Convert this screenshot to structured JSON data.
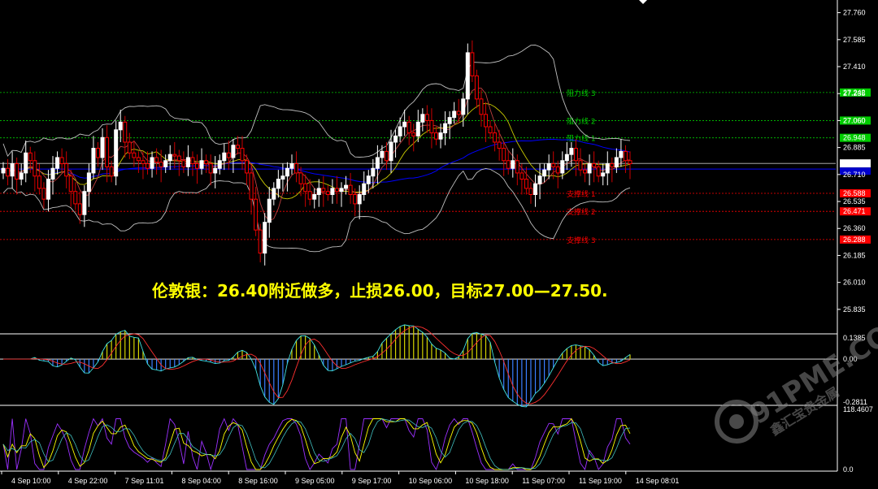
{
  "chart_data": {
    "type": "candlestick",
    "instrument_note": "伦敦银：26.40附近做多，止损26.00，目标27.00—27.50.",
    "price_axis": {
      "ylim": [
        25.75,
        27.8
      ],
      "ticks": [
        "27.760",
        "27.585",
        "27.410",
        "27.235",
        "27.060",
        "26.885",
        "26.710",
        "26.535",
        "26.360",
        "26.185",
        "26.010",
        "25.835"
      ]
    },
    "time_axis": {
      "labels": [
        "4 Sep 10:00",
        "4 Sep 22:00",
        "7 Sep 11:01",
        "8 Sep 04:00",
        "8 Sep 16:00",
        "9 Sep 05:00",
        "9 Sep 17:00",
        "10 Sep 06:00",
        "10 Sep 18:00",
        "11 Sep 07:00",
        "11 Sep 19:00",
        "14 Sep 08:01"
      ]
    },
    "current_price": "26.782",
    "levels": [
      {
        "name": "阻力线 3",
        "value": 27.242,
        "label": "27.242",
        "color": "#00cc00"
      },
      {
        "name": "阻力线 2",
        "value": 27.06,
        "label": "27.060",
        "color": "#00cc00"
      },
      {
        "name": "阻力线 1",
        "value": 26.948,
        "label": "26.948",
        "color": "#00cc00"
      },
      {
        "name": "支撑线 1",
        "value": 26.588,
        "label": "26.588",
        "color": "#ff0000"
      },
      {
        "name": "支撑线 2",
        "value": 26.471,
        "label": "26.471",
        "color": "#ff0000"
      },
      {
        "name": "支撑线 3",
        "value": 26.288,
        "label": "26.288",
        "color": "#ff0000"
      }
    ],
    "candles_close": [
      26.75,
      26.7,
      26.78,
      26.68,
      26.72,
      26.85,
      26.8,
      26.7,
      26.62,
      26.55,
      26.68,
      26.75,
      26.82,
      26.78,
      26.7,
      26.6,
      26.52,
      26.45,
      26.6,
      26.72,
      26.88,
      26.82,
      26.95,
      26.76,
      26.7,
      27.0,
      27.05,
      26.92,
      26.85,
      26.82,
      26.8,
      26.78,
      26.75,
      26.82,
      26.79,
      26.76,
      26.8,
      26.84,
      26.83,
      26.8,
      26.76,
      26.82,
      26.78,
      26.75,
      26.8,
      26.78,
      26.72,
      26.75,
      26.8,
      26.85,
      26.82,
      26.9,
      26.88,
      26.8,
      26.72,
      26.55,
      26.35,
      26.2,
      26.4,
      26.55,
      26.62,
      26.68,
      26.7,
      26.75,
      26.78,
      26.72,
      26.65,
      26.6,
      26.55,
      26.58,
      26.62,
      26.6,
      26.58,
      26.62,
      26.6,
      26.62,
      26.64,
      26.58,
      26.52,
      26.58,
      26.65,
      26.7,
      26.75,
      26.82,
      26.86,
      26.8,
      26.92,
      26.96,
      27.02,
      27.05,
      26.98,
      26.96,
      27.05,
      27.1,
      27.06,
      26.98,
      26.94,
      26.98,
      27.04,
      27.08,
      27.12,
      27.1,
      27.2,
      27.5,
      27.35,
      27.2,
      27.1,
      27.02,
      26.98,
      26.92,
      26.88,
      26.8,
      26.75,
      26.8,
      26.72,
      26.68,
      26.62,
      26.58,
      26.65,
      26.7,
      26.74,
      26.78,
      26.76,
      26.72,
      26.8,
      26.84,
      26.88,
      26.8,
      26.74,
      26.72,
      26.78,
      26.76,
      26.7,
      26.72,
      26.78,
      26.76,
      26.82,
      26.86,
      26.8,
      26.78
    ],
    "macd": {
      "ylim": [
        -0.2811,
        0.1385
      ],
      "ticks": [
        "0.1385",
        "0.00",
        "-0.2811"
      ]
    },
    "oscillator": {
      "ylim": [
        0.0,
        118.4607
      ],
      "ticks": [
        "118.4607",
        "0.0"
      ]
    }
  },
  "watermark": {
    "main": "91PME.COM",
    "sub": "鑫汇宝贵金属"
  },
  "colors": {
    "background": "#000000",
    "bull": "#ffffff",
    "bear": "#ff0000",
    "bull_wick": "#ffffff",
    "ma_blue": "#0000ff",
    "bollinger": "#c0c0c0",
    "ma_yellow": "#ffff00",
    "ma_red": "#ff4040",
    "grid_axis": "#ffffff",
    "annotation": "#ffff00"
  }
}
